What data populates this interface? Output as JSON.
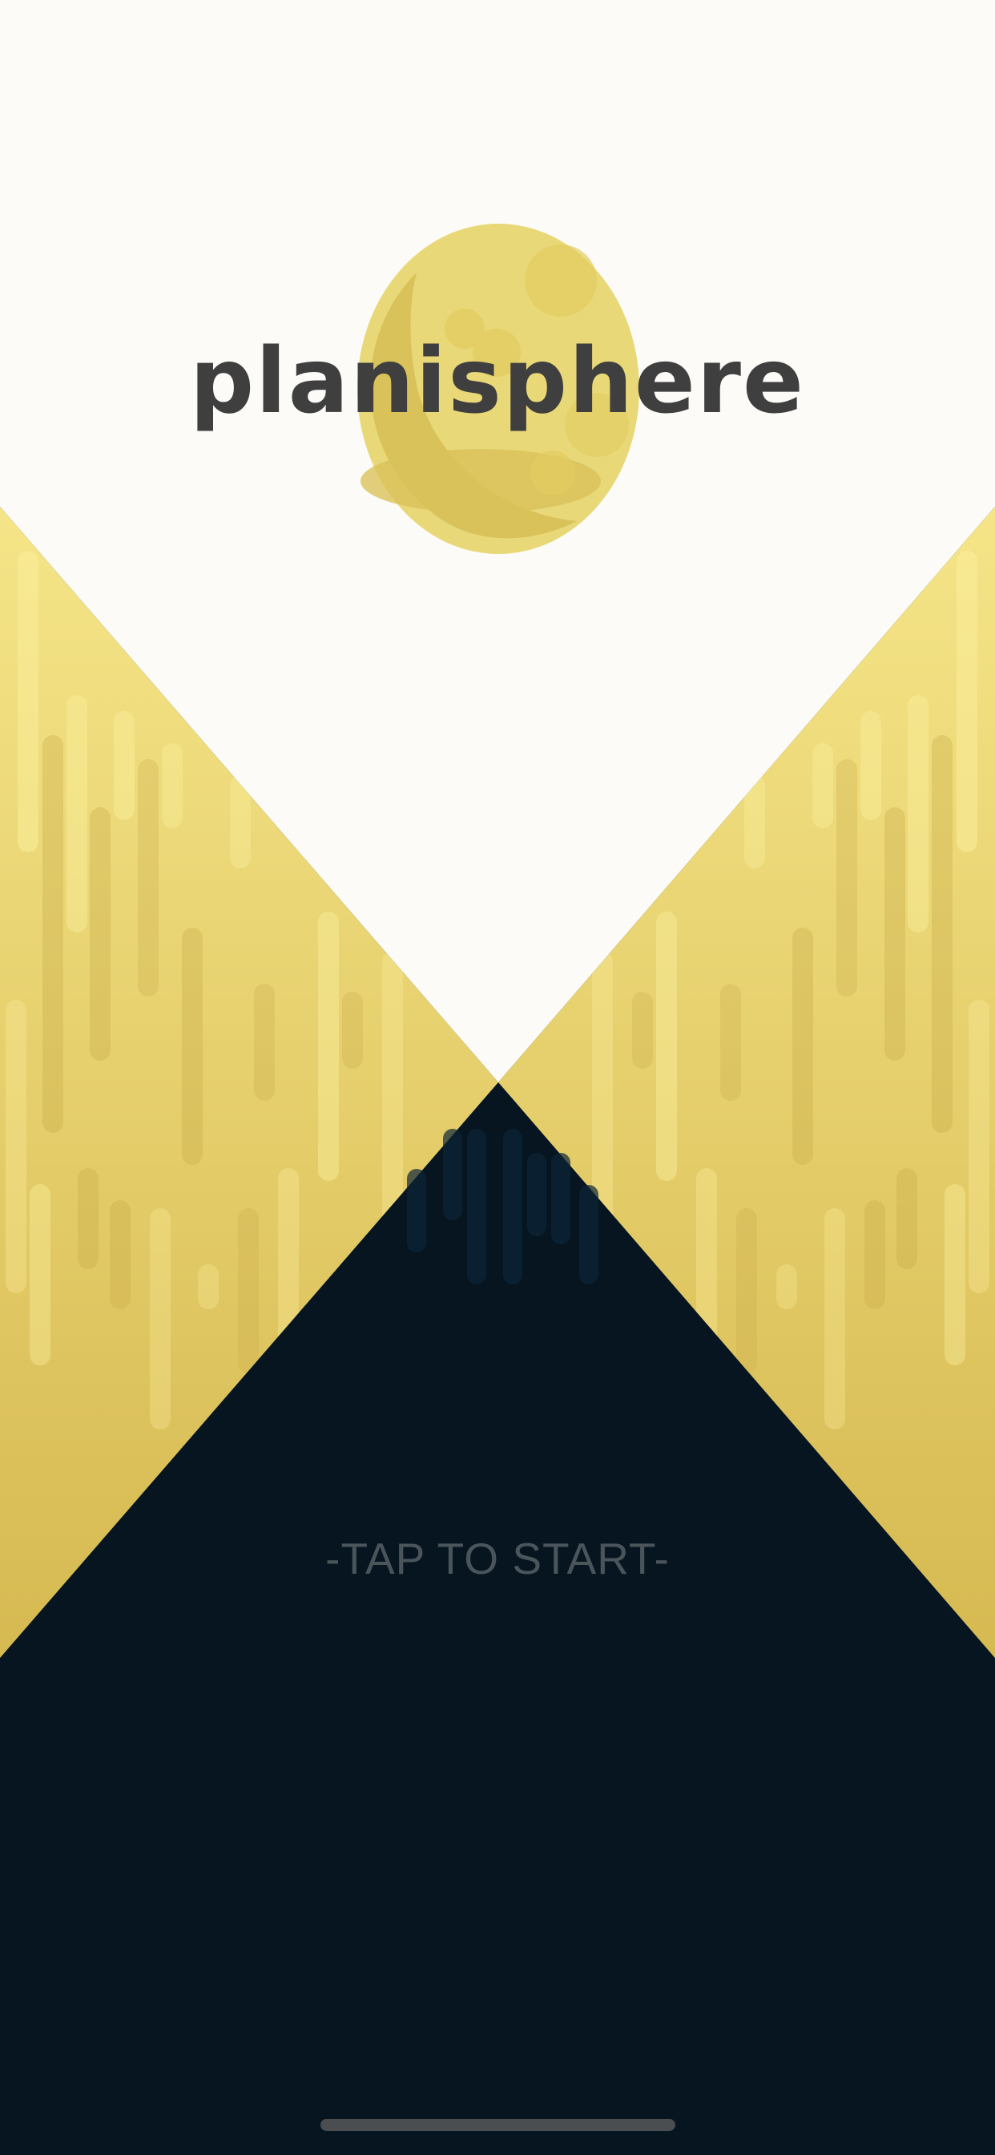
{
  "app": {
    "title": "planisphere",
    "start_prompt": "-TAP TO START-"
  },
  "icons": {
    "logo": "moon-icon"
  },
  "colors": {
    "sky": "#fcfbf8",
    "night": "#061520",
    "moon": "#e9d877",
    "moon_shadow": "#d9c25a",
    "gold_light": "#f5e588",
    "gold_dark": "#d6b951",
    "title_text": "#3f3f3f",
    "prompt_text": "#4a545b"
  }
}
